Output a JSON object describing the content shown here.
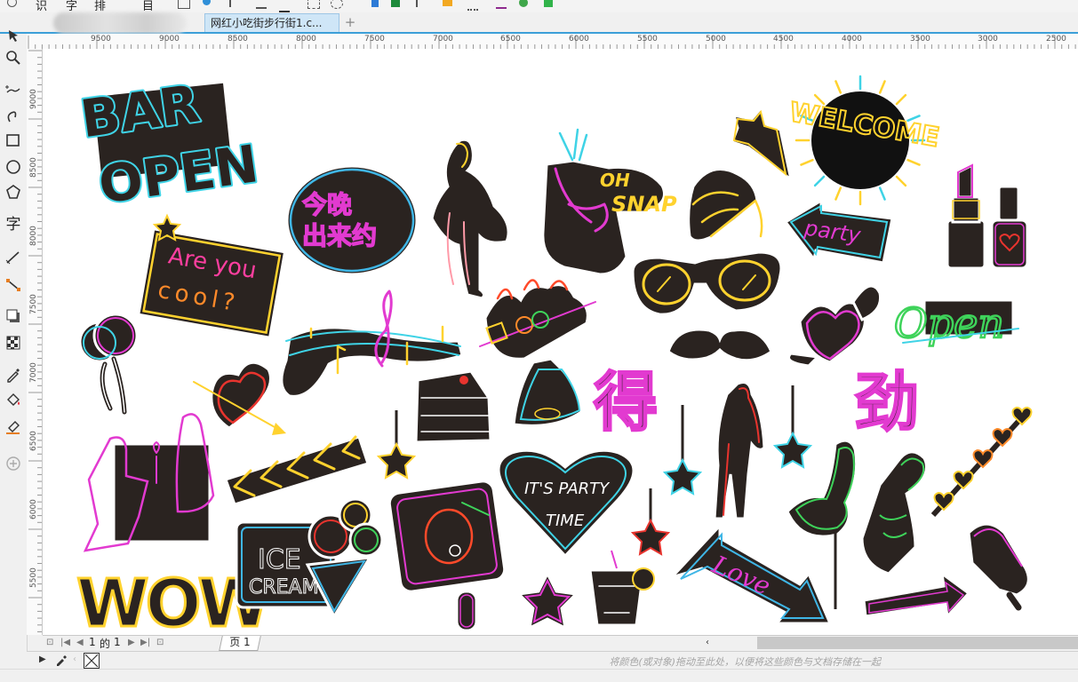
{
  "menu": {
    "items": [
      "识",
      "字",
      "排",
      "目"
    ]
  },
  "document": {
    "tab_title": "网红小吃街步行街1.c...",
    "new_tab": "+"
  },
  "ruler": {
    "h_labels": [
      "9500",
      "9000",
      "8500",
      "8000",
      "7500",
      "7000",
      "6500",
      "6000",
      "5500",
      "5000",
      "4500",
      "4000",
      "3500",
      "3000",
      "2500"
    ],
    "v_labels": [
      "9000",
      "8500",
      "8000",
      "7500",
      "7000",
      "6500",
      "6000",
      "5500"
    ]
  },
  "tools": [
    "pick",
    "zoom",
    "freehand",
    "curve",
    "rectangle",
    "ellipse",
    "polygon",
    "text",
    "parallel-dimension",
    "connector",
    "drop-shadow",
    "transparency",
    "eyedropper",
    "interactive-fill",
    "smart-fill",
    "add"
  ],
  "tool_text_label": "字",
  "stickers": {
    "bar": "BAR",
    "open": "OPEN",
    "tonight_line1": "今晚",
    "tonight_line2": "出来约",
    "are_you": "Are you",
    "cool": "cool?",
    "oh": "OH",
    "snap": "SNAP",
    "welcome": "WELCOME",
    "party": "party",
    "open_script": "Open",
    "de": "得",
    "jin": "劲",
    "its_party": "IT'S PARTY",
    "time": "TIME",
    "ice": "ICE",
    "cream": "CREAM",
    "wow": "WOW",
    "love": "Love"
  },
  "pager": {
    "current": "1",
    "of": "的",
    "total": "1",
    "page_label": "页 1"
  },
  "statusbar": {
    "color_hint": "将颜色(或对象)拖动至此处，以便将这些颜色与文档存储在一起"
  },
  "colors": {
    "accent": "#3c9fd8",
    "sticker_body": "#2a2320",
    "cyan": "#3fd3e6",
    "magenta": "#e23ad0",
    "yellow": "#ffd22e",
    "orange": "#ff8a2a",
    "green": "#3ed35a",
    "red": "#e8342e"
  }
}
